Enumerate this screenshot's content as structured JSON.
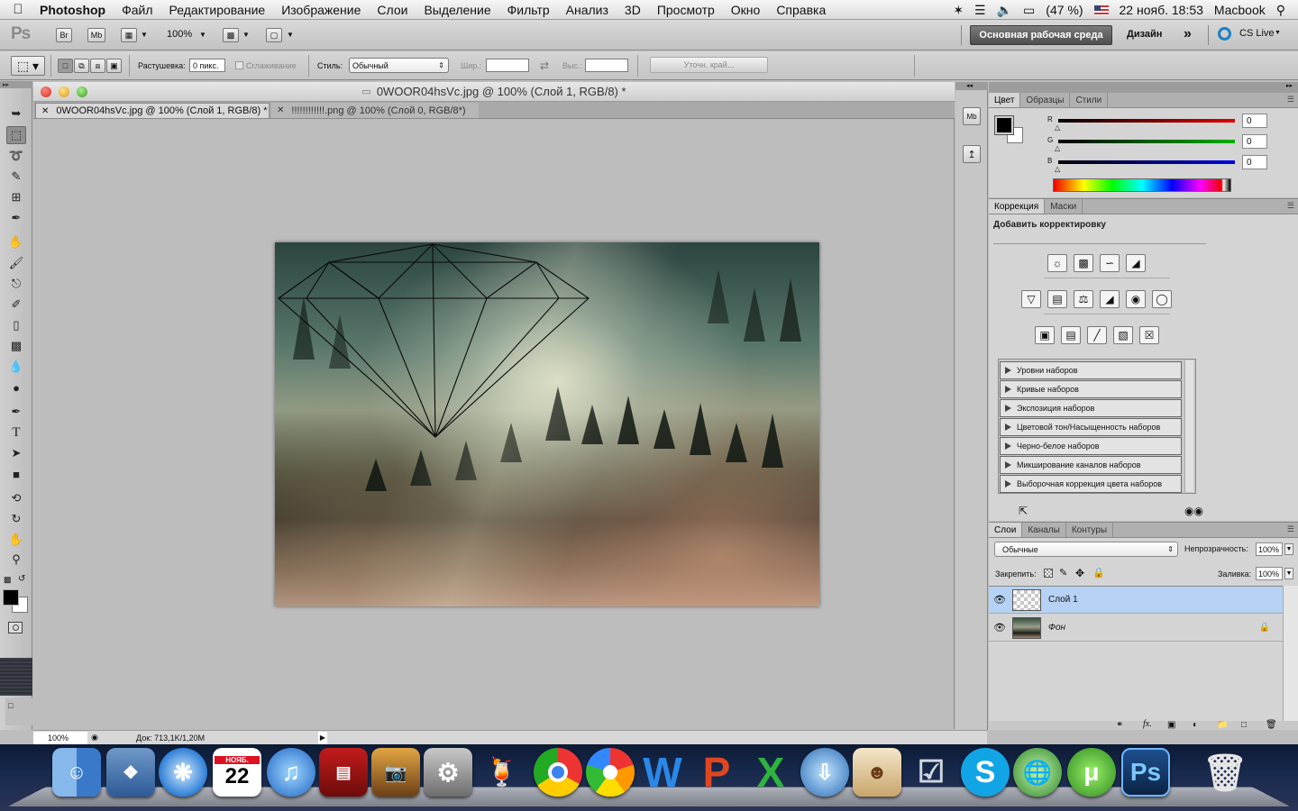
{
  "menubar": {
    "app": "Photoshop",
    "items": [
      "Файл",
      "Редактирование",
      "Изображение",
      "Слои",
      "Выделение",
      "Фильтр",
      "Анализ",
      "3D",
      "Просмотр",
      "Окно",
      "Справка"
    ],
    "battery": "(47 %)",
    "datetime": "22 нояб. 18:53",
    "user": "Macbook"
  },
  "appbar": {
    "logo": "Ps",
    "br": "Br",
    "mb": "Mb",
    "zoom": "100%",
    "workspace": "Основная рабочая среда",
    "design": "Дизайн",
    "more": "»",
    "cslive": "CS Live"
  },
  "options": {
    "feather_label": "Растушевка:",
    "feather_value": "0 пикс.",
    "antialias": "Сглаживание",
    "style_label": "Стиль:",
    "style_value": "Обычный",
    "width_label": "Шир.:",
    "height_label": "Выс.:",
    "refine_edge": "Уточн. край..."
  },
  "document": {
    "title": "0WOOR04hsVc.jpg @ 100% (Слой 1, RGB/8) *",
    "tabs": [
      {
        "label": "0WOOR04hsVc.jpg @ 100% (Слой 1, RGB/8) *",
        "active": true
      },
      {
        "label": "!!!!!!!!!!!!.png @ 100% (Слой 0, RGB/8*)",
        "active": false
      }
    ]
  },
  "status": {
    "zoom": "100%",
    "doc": "Док: 713,1K/1,20M"
  },
  "color_panel": {
    "tabs": [
      "Цвет",
      "Образцы",
      "Стили"
    ],
    "channels": [
      {
        "label": "R",
        "value": "0",
        "color": "#e00000"
      },
      {
        "label": "G",
        "value": "0",
        "color": "#00b000"
      },
      {
        "label": "B",
        "value": "0",
        "color": "#0000e0"
      }
    ]
  },
  "adjust_panel": {
    "tabs": [
      "Коррекция",
      "Маски"
    ],
    "heading": "Добавить корректировку",
    "presets": [
      "Уровни наборов",
      "Кривые наборов",
      "Экспозиция наборов",
      "Цветовой тон/Насыщенность наборов",
      "Черно-белое наборов",
      "Микширование каналов наборов",
      "Выборочная коррекция цвета наборов"
    ]
  },
  "layers_panel": {
    "tabs": [
      "Слои",
      "Каналы",
      "Контуры"
    ],
    "blend_mode": "Обычные",
    "opacity_label": "Непрозрачность:",
    "opacity_value": "100%",
    "lock_label": "Закрепить:",
    "fill_label": "Заливка:",
    "fill_value": "100%",
    "layers": [
      {
        "name": "Слой 1",
        "selected": true
      },
      {
        "name": "Фон",
        "selected": false,
        "locked": true
      }
    ]
  },
  "dock": {
    "calendar_month": "НОЯБ.",
    "calendar_day": "22",
    "apps": [
      "finder",
      "preview",
      "safari",
      "calendar",
      "itunes",
      "photobooth",
      "iphoto",
      "system-preferences",
      "cocktail",
      "chrome",
      "picasa",
      "word",
      "powerpoint",
      "excel",
      "network-utility",
      "address-book",
      "remote-desktop",
      "skype",
      "internet",
      "utorrent",
      "photoshop",
      "trash"
    ]
  }
}
